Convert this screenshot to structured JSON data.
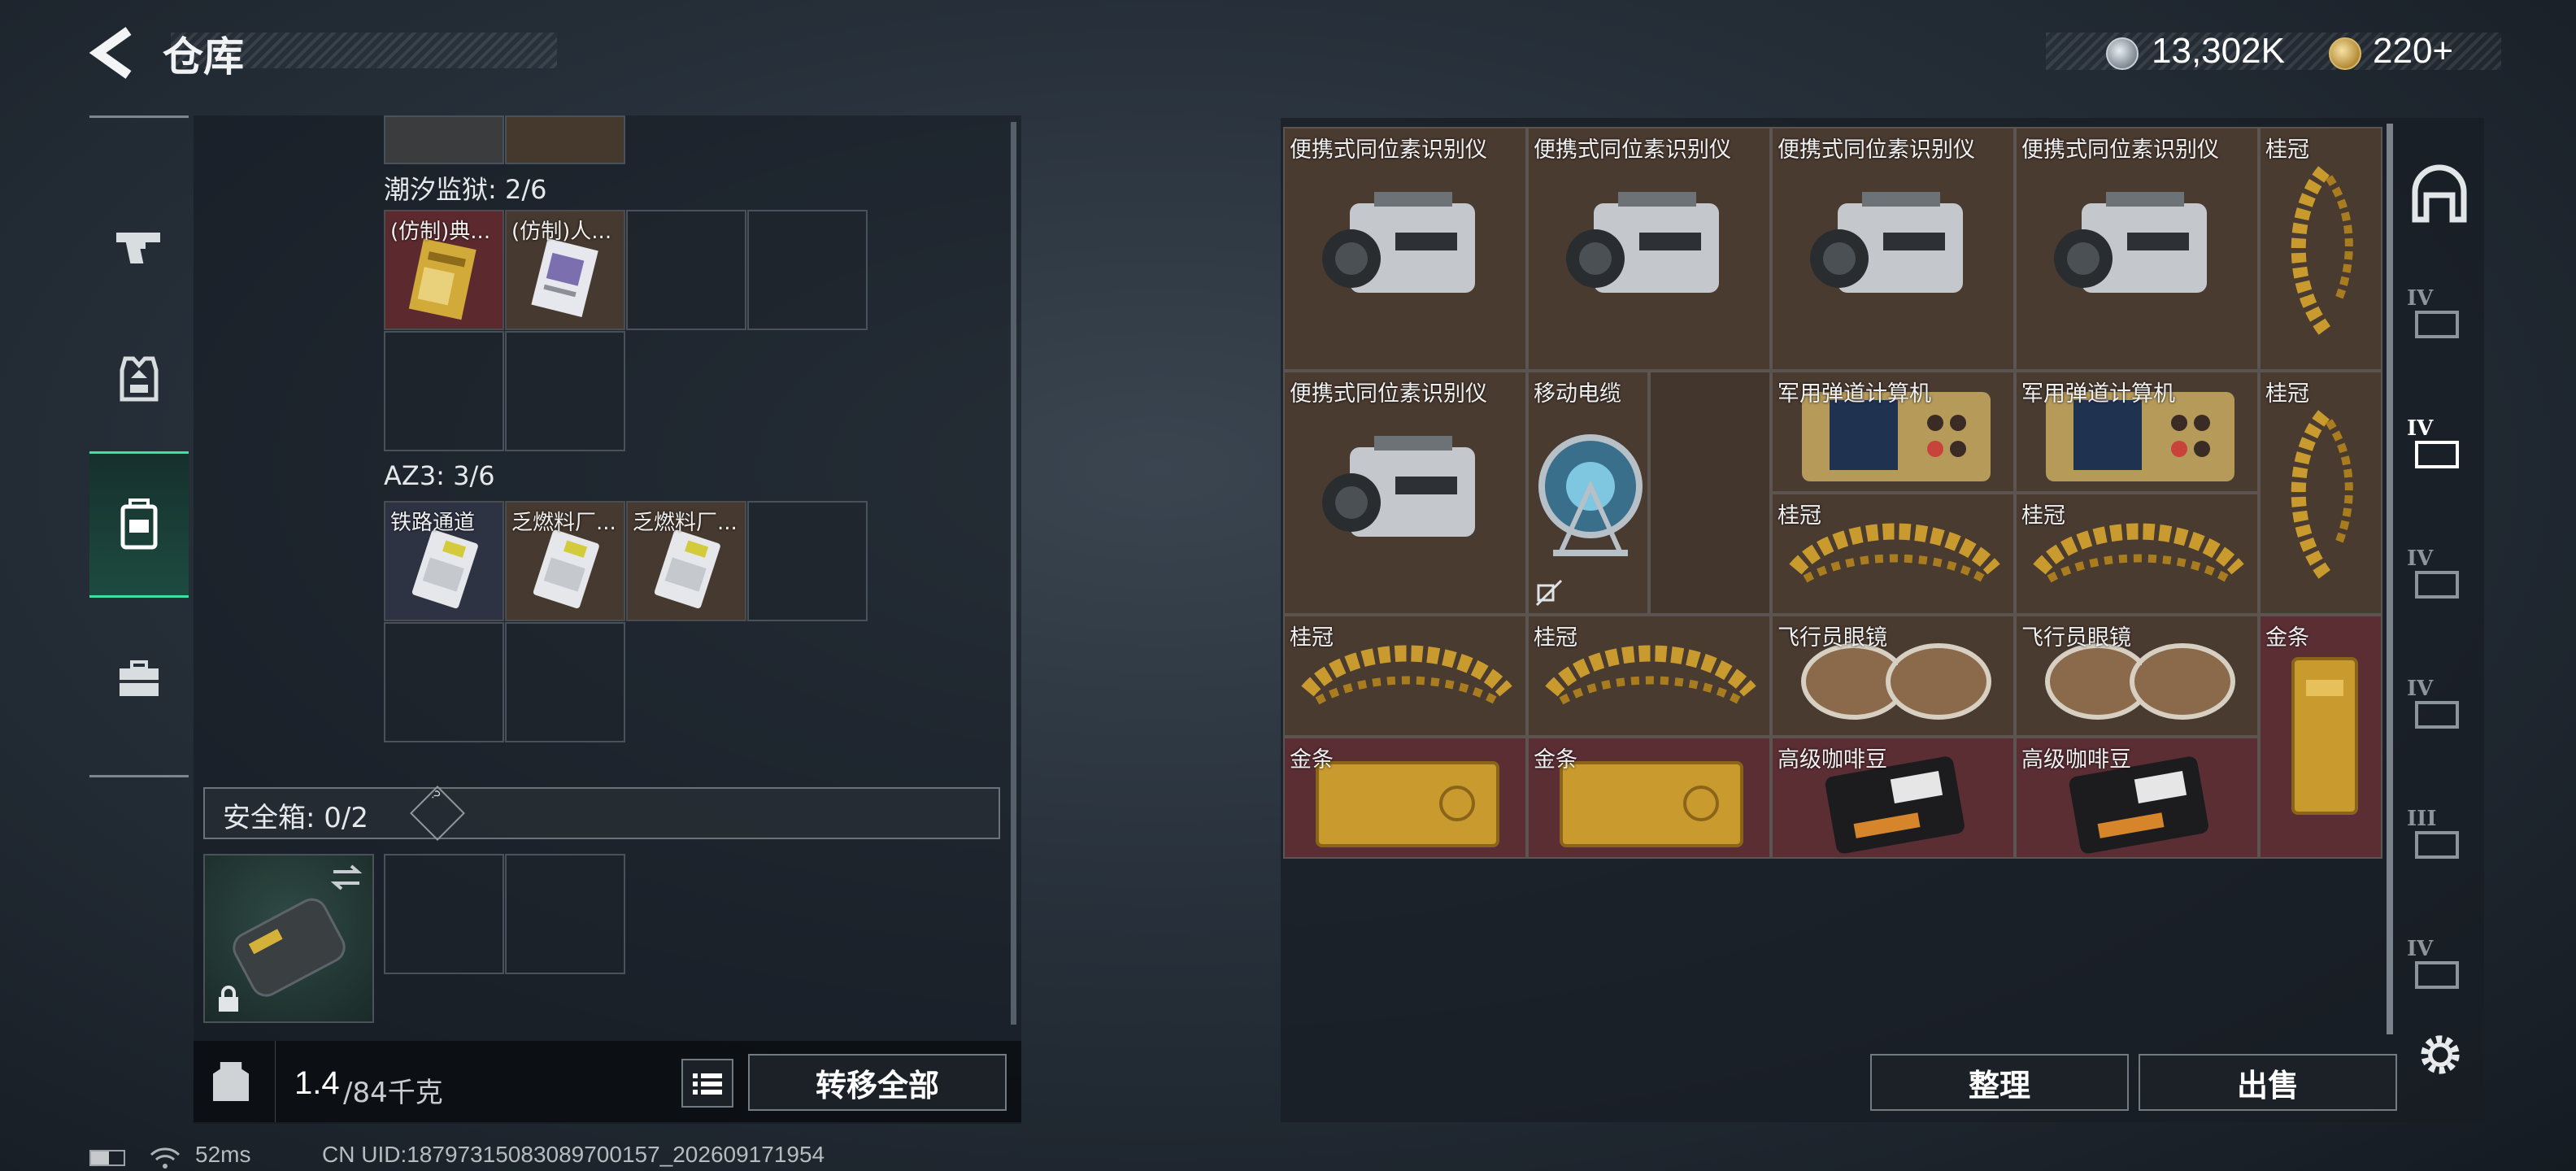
{
  "header": {
    "title": "仓库",
    "currency_silver": "13,302K",
    "currency_gold": "220+"
  },
  "colors": {
    "accent_green": "#3de0a0",
    "cell_brown": "#4a3b31",
    "cell_red": "#5b2e34"
  },
  "left_nav": {
    "items": [
      {
        "icon": "gun-icon"
      },
      {
        "icon": "vest-icon"
      },
      {
        "icon": "backpack-icon",
        "active": true
      },
      {
        "icon": "toolbox-icon"
      }
    ]
  },
  "containers": {
    "tide_prison": {
      "label": "潮汐监狱: 2/6",
      "items": [
        "(仿制)典...",
        "(仿制)人..."
      ]
    },
    "az3": {
      "label": "AZ3: 3/6",
      "items": [
        "铁路通道",
        "乏燃料厂...",
        "乏燃料厂..."
      ]
    },
    "safe_box": {
      "label": "安全箱: 0/2",
      "help": "?"
    }
  },
  "weight": {
    "current": "1.4",
    "max": "/84千克"
  },
  "buttons": {
    "transfer_all": "转移全部",
    "organize": "整理",
    "sell": "出售"
  },
  "inventory": {
    "items": [
      {
        "name": "便携式同位素识别仪"
      },
      {
        "name": "便携式同位素识别仪"
      },
      {
        "name": "便携式同位素识别仪"
      },
      {
        "name": "便携式同位素识别仪"
      },
      {
        "name": "桂冠"
      },
      {
        "name": "便携式同位素识别仪"
      },
      {
        "name": "移动电缆"
      },
      {
        "name": "军用弹道计算机"
      },
      {
        "name": "军用弹道计算机"
      },
      {
        "name": "桂冠"
      },
      {
        "name": "桂冠"
      },
      {
        "name": "桂冠"
      },
      {
        "name": "桂冠"
      },
      {
        "name": "桂冠"
      },
      {
        "name": "飞行员眼镜"
      },
      {
        "name": "飞行员眼镜"
      },
      {
        "name": "金条"
      },
      {
        "name": "金条"
      },
      {
        "name": "金条"
      },
      {
        "name": "高级咖啡豆"
      },
      {
        "name": "高级咖啡豆"
      }
    ],
    "side_tabs": [
      "helmet-tab-icon",
      "IV",
      "IV",
      "IV",
      "IV",
      "III",
      "IV"
    ]
  },
  "status": {
    "ping": "52ms",
    "uid": "CN UID:18797315083089700157_202609171954"
  }
}
